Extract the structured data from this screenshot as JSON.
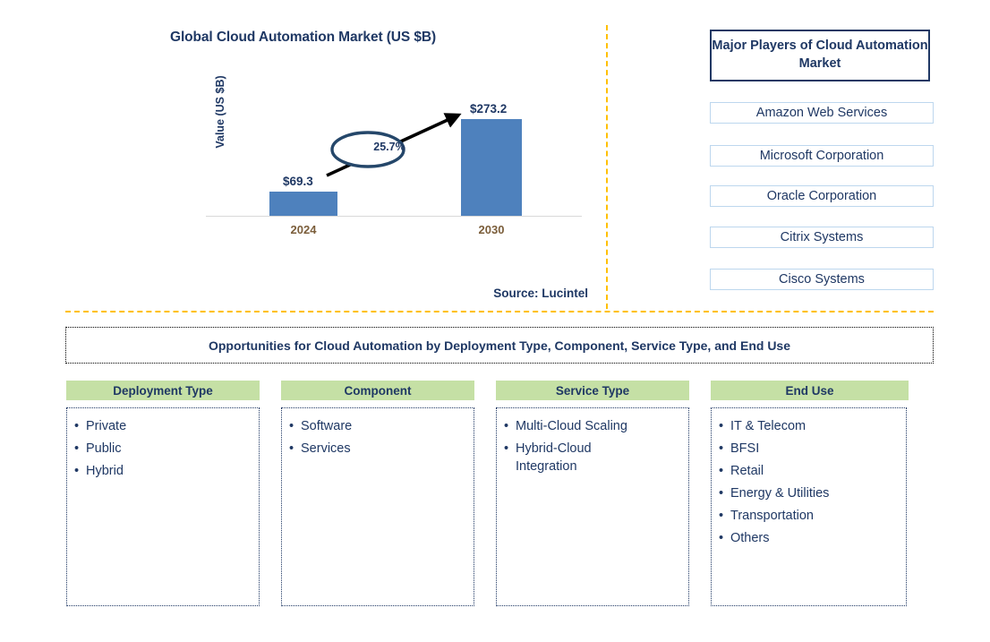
{
  "chart_panel": {
    "title": "Global Cloud Automation Market (US $B)",
    "y_axis_label": "Value (US $B)",
    "source": "Source: Lucintel",
    "cagr_label": "25.7%"
  },
  "chart_data": {
    "type": "bar",
    "title": "Global Cloud Automation Market (US $B)",
    "categories": [
      "2024",
      "2030"
    ],
    "values": [
      69.3,
      273.2
    ],
    "data_labels": [
      "$69.3",
      "$273.2"
    ],
    "xlabel": "",
    "ylabel": "Value (US $B)",
    "ylim": [
      0,
      300
    ],
    "grid": false,
    "legend": "none",
    "annotations": [
      {
        "type": "cagr-arrow",
        "label": "25.7%",
        "from": "2024",
        "to": "2030"
      }
    ],
    "series_color": "#4E81BD",
    "source": "Source: Lucintel"
  },
  "players": {
    "header": "Major Players of Cloud Automation Market",
    "items": [
      "Amazon Web Services",
      "Microsoft Corporation",
      "Oracle Corporation",
      "Citrix Systems",
      "Cisco Systems"
    ]
  },
  "opportunities": {
    "title": "Opportunities for Cloud Automation by Deployment Type, Component, Service Type, and End Use",
    "columns": [
      {
        "header": "Deployment Type",
        "items": [
          "Private",
          "Public",
          "Hybrid"
        ]
      },
      {
        "header": "Component",
        "items": [
          "Software",
          "Services"
        ]
      },
      {
        "header": "Service Type",
        "items": [
          "Multi-Cloud Scaling",
          "Hybrid-Cloud\nIntegration"
        ]
      },
      {
        "header": "End Use",
        "items": [
          "IT & Telecom",
          "BFSI",
          "Retail",
          "Energy & Utilities",
          "Transportation",
          "Others"
        ]
      }
    ]
  },
  "colors": {
    "bar": "#4E81BD",
    "navy": "#1F3864",
    "divider": "#FFC000",
    "header_green": "#C5E0A5",
    "player_border": "#BDD7EE",
    "tick_brown": "#7B5E3B"
  }
}
